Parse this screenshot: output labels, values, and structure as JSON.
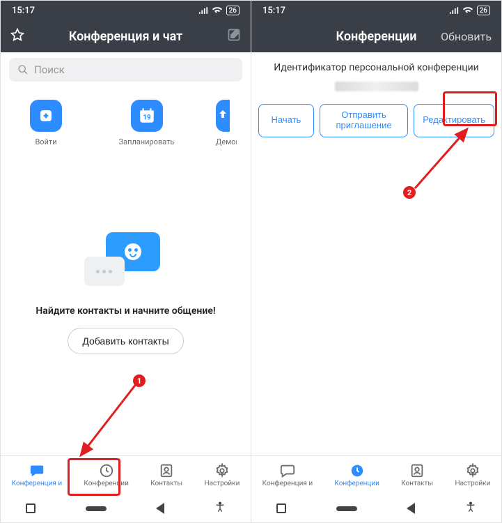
{
  "status": {
    "time": "15:17",
    "battery": "26"
  },
  "left": {
    "title": "Конференция и чат",
    "search_placeholder": "Поиск",
    "actions": {
      "join": "Войти",
      "schedule": "Запланировать",
      "share": "Демонстра",
      "calendar_day": "19"
    },
    "empty": {
      "find_text": "Найдите контакты и начните общение!",
      "add_contacts": "Добавить контакты"
    },
    "tabs": {
      "chat": "Конференция и",
      "meetings": "Конференции",
      "contacts": "Контакты",
      "settings": "Настройки"
    },
    "badge": "1"
  },
  "right": {
    "title": "Конференции",
    "refresh": "Обновить",
    "pii_label": "Идентификатор персональной конференции",
    "buttons": {
      "start": "Начать",
      "invite": "Отправить приглашение",
      "edit": "Редактировать"
    },
    "tabs": {
      "chat": "Конференция и",
      "meetings": "Конференции",
      "contacts": "Контакты",
      "settings": "Настройки"
    },
    "badge": "2"
  }
}
